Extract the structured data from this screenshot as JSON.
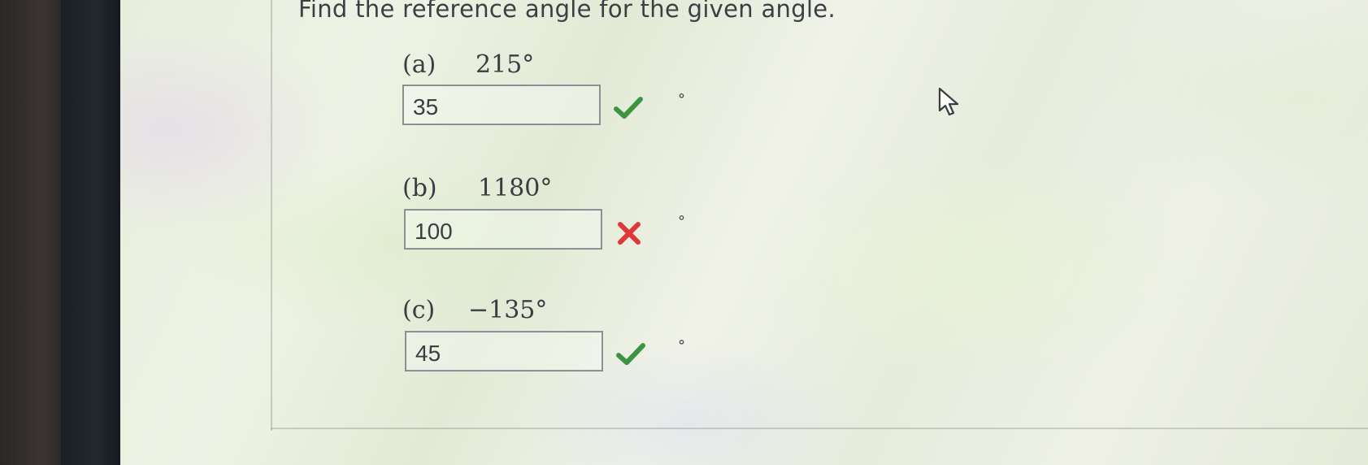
{
  "question": {
    "title": "Find the reference angle for the given angle."
  },
  "parts": [
    {
      "label": "(a)",
      "angle": "215°",
      "answer": "35",
      "status": "correct",
      "unit": "°"
    },
    {
      "label": "(b)",
      "angle": "1180°",
      "answer": "100",
      "status": "incorrect",
      "unit": "°"
    },
    {
      "label": "(c)",
      "angle": "−135°",
      "answer": "45",
      "status": "correct",
      "unit": "°"
    }
  ],
  "colors": {
    "correct": "#3d9440",
    "incorrect": "#e03838"
  },
  "icons": {
    "correct": "checkmark-icon",
    "incorrect": "x-mark-icon",
    "cursor": "mouse-pointer-icon"
  }
}
